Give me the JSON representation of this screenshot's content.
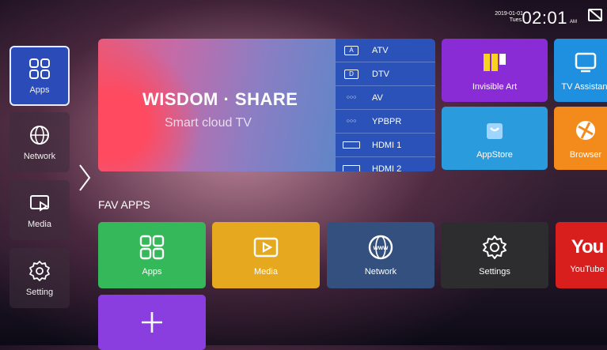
{
  "status": {
    "date": "2019-01-01",
    "weekday": "Tues.",
    "time": "02:01",
    "ampm": "AM"
  },
  "sidebar": {
    "items": [
      {
        "label": "Apps",
        "icon": "grid-icon",
        "active": true
      },
      {
        "label": "Network",
        "icon": "globe-icon",
        "active": false
      },
      {
        "label": "Media",
        "icon": "media-icon",
        "active": false
      },
      {
        "label": "Setting",
        "icon": "gear-icon",
        "active": false
      }
    ]
  },
  "banner": {
    "title": "WISDOM · SHARE",
    "subtitle": "Smart cloud TV"
  },
  "sources": [
    {
      "name": "ATV",
      "icon_text": "A"
    },
    {
      "name": "DTV",
      "icon_text": "D"
    },
    {
      "name": "AV",
      "icon_text": "○○○"
    },
    {
      "name": "YPBPR",
      "icon_text": "○○○"
    },
    {
      "name": "HDMI 1",
      "icon_text": ""
    },
    {
      "name": "HDMI 2",
      "icon_text": ""
    }
  ],
  "top_apps": [
    {
      "label": "Invisible Art",
      "color": "#8a2cd6"
    },
    {
      "label": "TV Assistant",
      "color": "#1f8fe0"
    },
    {
      "label": "AppStore",
      "color": "#2a9bdc"
    },
    {
      "label": "Browser",
      "color": "#f28a1c"
    }
  ],
  "fav": {
    "title": "FAV APPS",
    "items": [
      {
        "label": "Apps",
        "color": "#35b85a"
      },
      {
        "label": "Media",
        "color": "#e6a81e"
      },
      {
        "label": "Network",
        "color": "#33507f"
      },
      {
        "label": "Settings",
        "color": "#2d2d30"
      },
      {
        "label": "YouTube",
        "color": "#d91e1e"
      }
    ],
    "add_color": "#8a3ee0"
  }
}
